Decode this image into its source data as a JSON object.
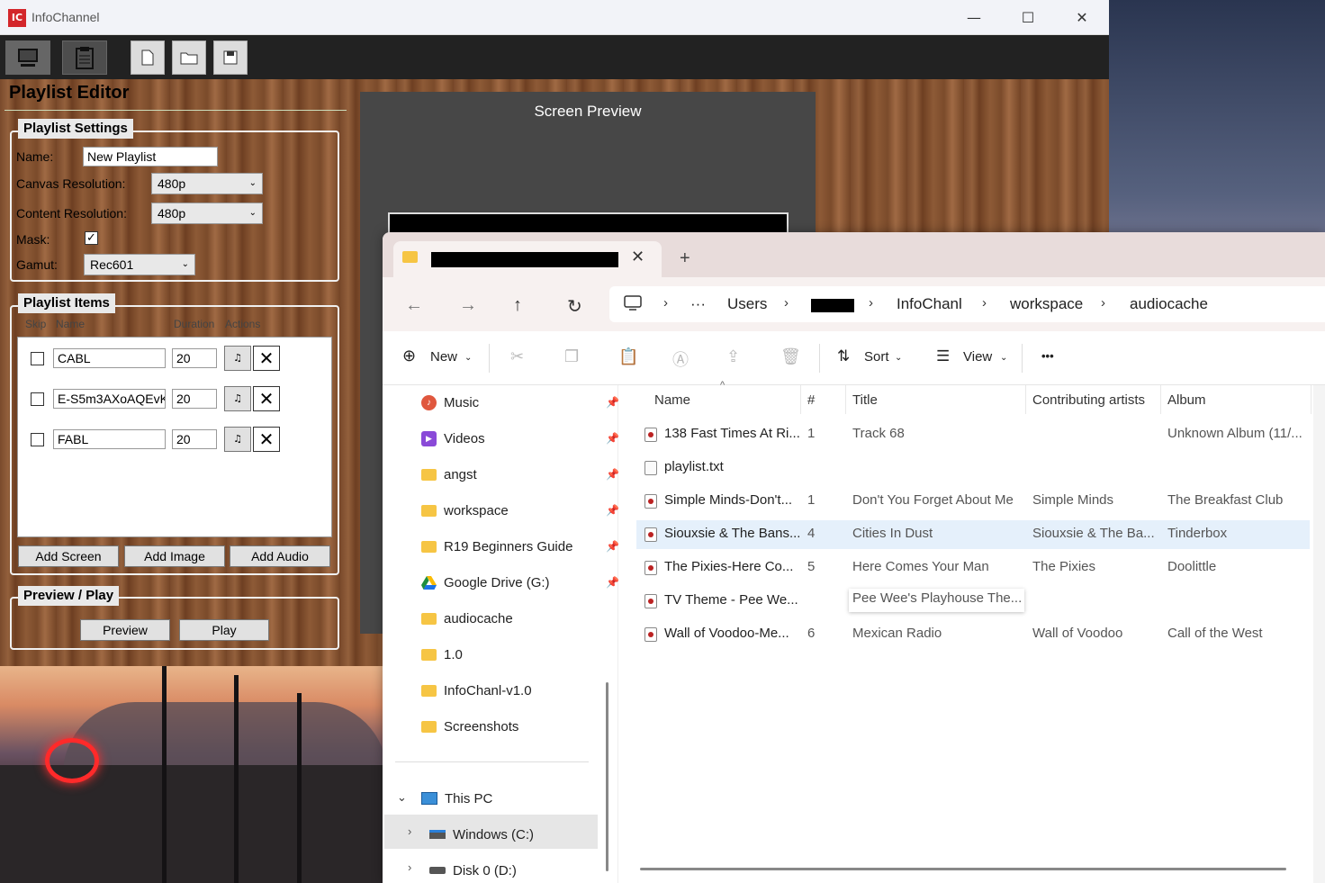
{
  "app": {
    "title": "InfoChannel",
    "logo_text": "IC",
    "window_controls": {
      "minimize": "—",
      "maximize": "☐",
      "close": "✕"
    }
  },
  "toolbar": {
    "buttons": [
      "monitor-icon",
      "clipboard-icon",
      "new-file-icon",
      "open-folder-icon",
      "save-icon"
    ]
  },
  "editor": {
    "title": "Playlist Editor",
    "settings": {
      "group_title": "Playlist Settings",
      "name_label": "Name:",
      "name_value": "New Playlist",
      "canvas_label": "Canvas Resolution:",
      "canvas_value": "480p",
      "content_label": "Content Resolution:",
      "content_value": "480p",
      "mask_label": "Mask:",
      "mask_checked": true,
      "gamut_label": "Gamut:",
      "gamut_value": "Rec601"
    },
    "items": {
      "group_title": "Playlist Items",
      "headers": {
        "skip": "Skip",
        "name": "Name",
        "duration": "Duration",
        "actions": "Actions"
      },
      "rows": [
        {
          "name": "CABL",
          "duration": "20"
        },
        {
          "name": "E-S5m3AXoAQEvK",
          "duration": "20"
        },
        {
          "name": "FABL",
          "duration": "20"
        }
      ],
      "add_screen": "Add Screen",
      "add_image": "Add Image",
      "add_audio": "Add Audio"
    },
    "preview_play": {
      "group_title": "Preview / Play",
      "preview": "Preview",
      "play": "Play"
    }
  },
  "screen_preview": {
    "title": "Screen Preview"
  },
  "explorer": {
    "new_tab": "+",
    "breadcrumb": [
      "Users",
      "InfoChanl",
      "workspace",
      "audiocache"
    ],
    "commands": {
      "new": "New",
      "sort": "Sort",
      "view": "View",
      "more": "•••"
    },
    "nav_items": [
      {
        "label": "Music",
        "pinned": true
      },
      {
        "label": "Videos",
        "pinned": true
      },
      {
        "label": "angst",
        "pinned": true
      },
      {
        "label": "workspace",
        "pinned": true
      },
      {
        "label": "R19 Beginners Guide",
        "pinned": true
      },
      {
        "label": "Google Drive (G:)",
        "pinned": true
      },
      {
        "label": "audiocache",
        "pinned": false
      },
      {
        "label": "1.0",
        "pinned": false
      },
      {
        "label": "InfoChanl-v1.0",
        "pinned": false
      },
      {
        "label": "Screenshots",
        "pinned": false
      }
    ],
    "this_pc": "This PC",
    "drives": [
      "Windows (C:)",
      "Disk 0 (D:)"
    ],
    "columns": {
      "name": "Name",
      "num": "#",
      "title": "Title",
      "artists": "Contributing artists",
      "album": "Album"
    },
    "files": [
      {
        "name": "138 Fast Times At Ri...",
        "num": "1",
        "title": "Track 68",
        "artist": "",
        "album": "Unknown Album (11/...",
        "type": "audio"
      },
      {
        "name": "playlist.txt",
        "num": "",
        "title": "",
        "artist": "",
        "album": "",
        "type": "text"
      },
      {
        "name": "Simple Minds-Don't...",
        "num": "1",
        "title": "Don't You Forget About Me",
        "artist": "Simple Minds",
        "album": "The Breakfast Club",
        "type": "audio"
      },
      {
        "name": "Siouxsie & The Bans...",
        "num": "4",
        "title": "Cities In Dust",
        "artist": "Siouxsie & The Ba...",
        "album": "Tinderbox",
        "type": "audio"
      },
      {
        "name": "The Pixies-Here Co...",
        "num": "5",
        "title": "Here Comes Your Man",
        "artist": "The Pixies",
        "album": "Doolittle",
        "type": "audio"
      },
      {
        "name": "TV Theme - Pee We...",
        "num": "",
        "title": "Pee Wee's Playhouse The...",
        "artist": "",
        "album": "",
        "type": "audio"
      },
      {
        "name": "Wall of Voodoo-Me...",
        "num": "6",
        "title": "Mexican Radio",
        "artist": "Wall of Voodoo",
        "album": "Call of the West",
        "type": "audio"
      }
    ],
    "selected_row": 3
  }
}
